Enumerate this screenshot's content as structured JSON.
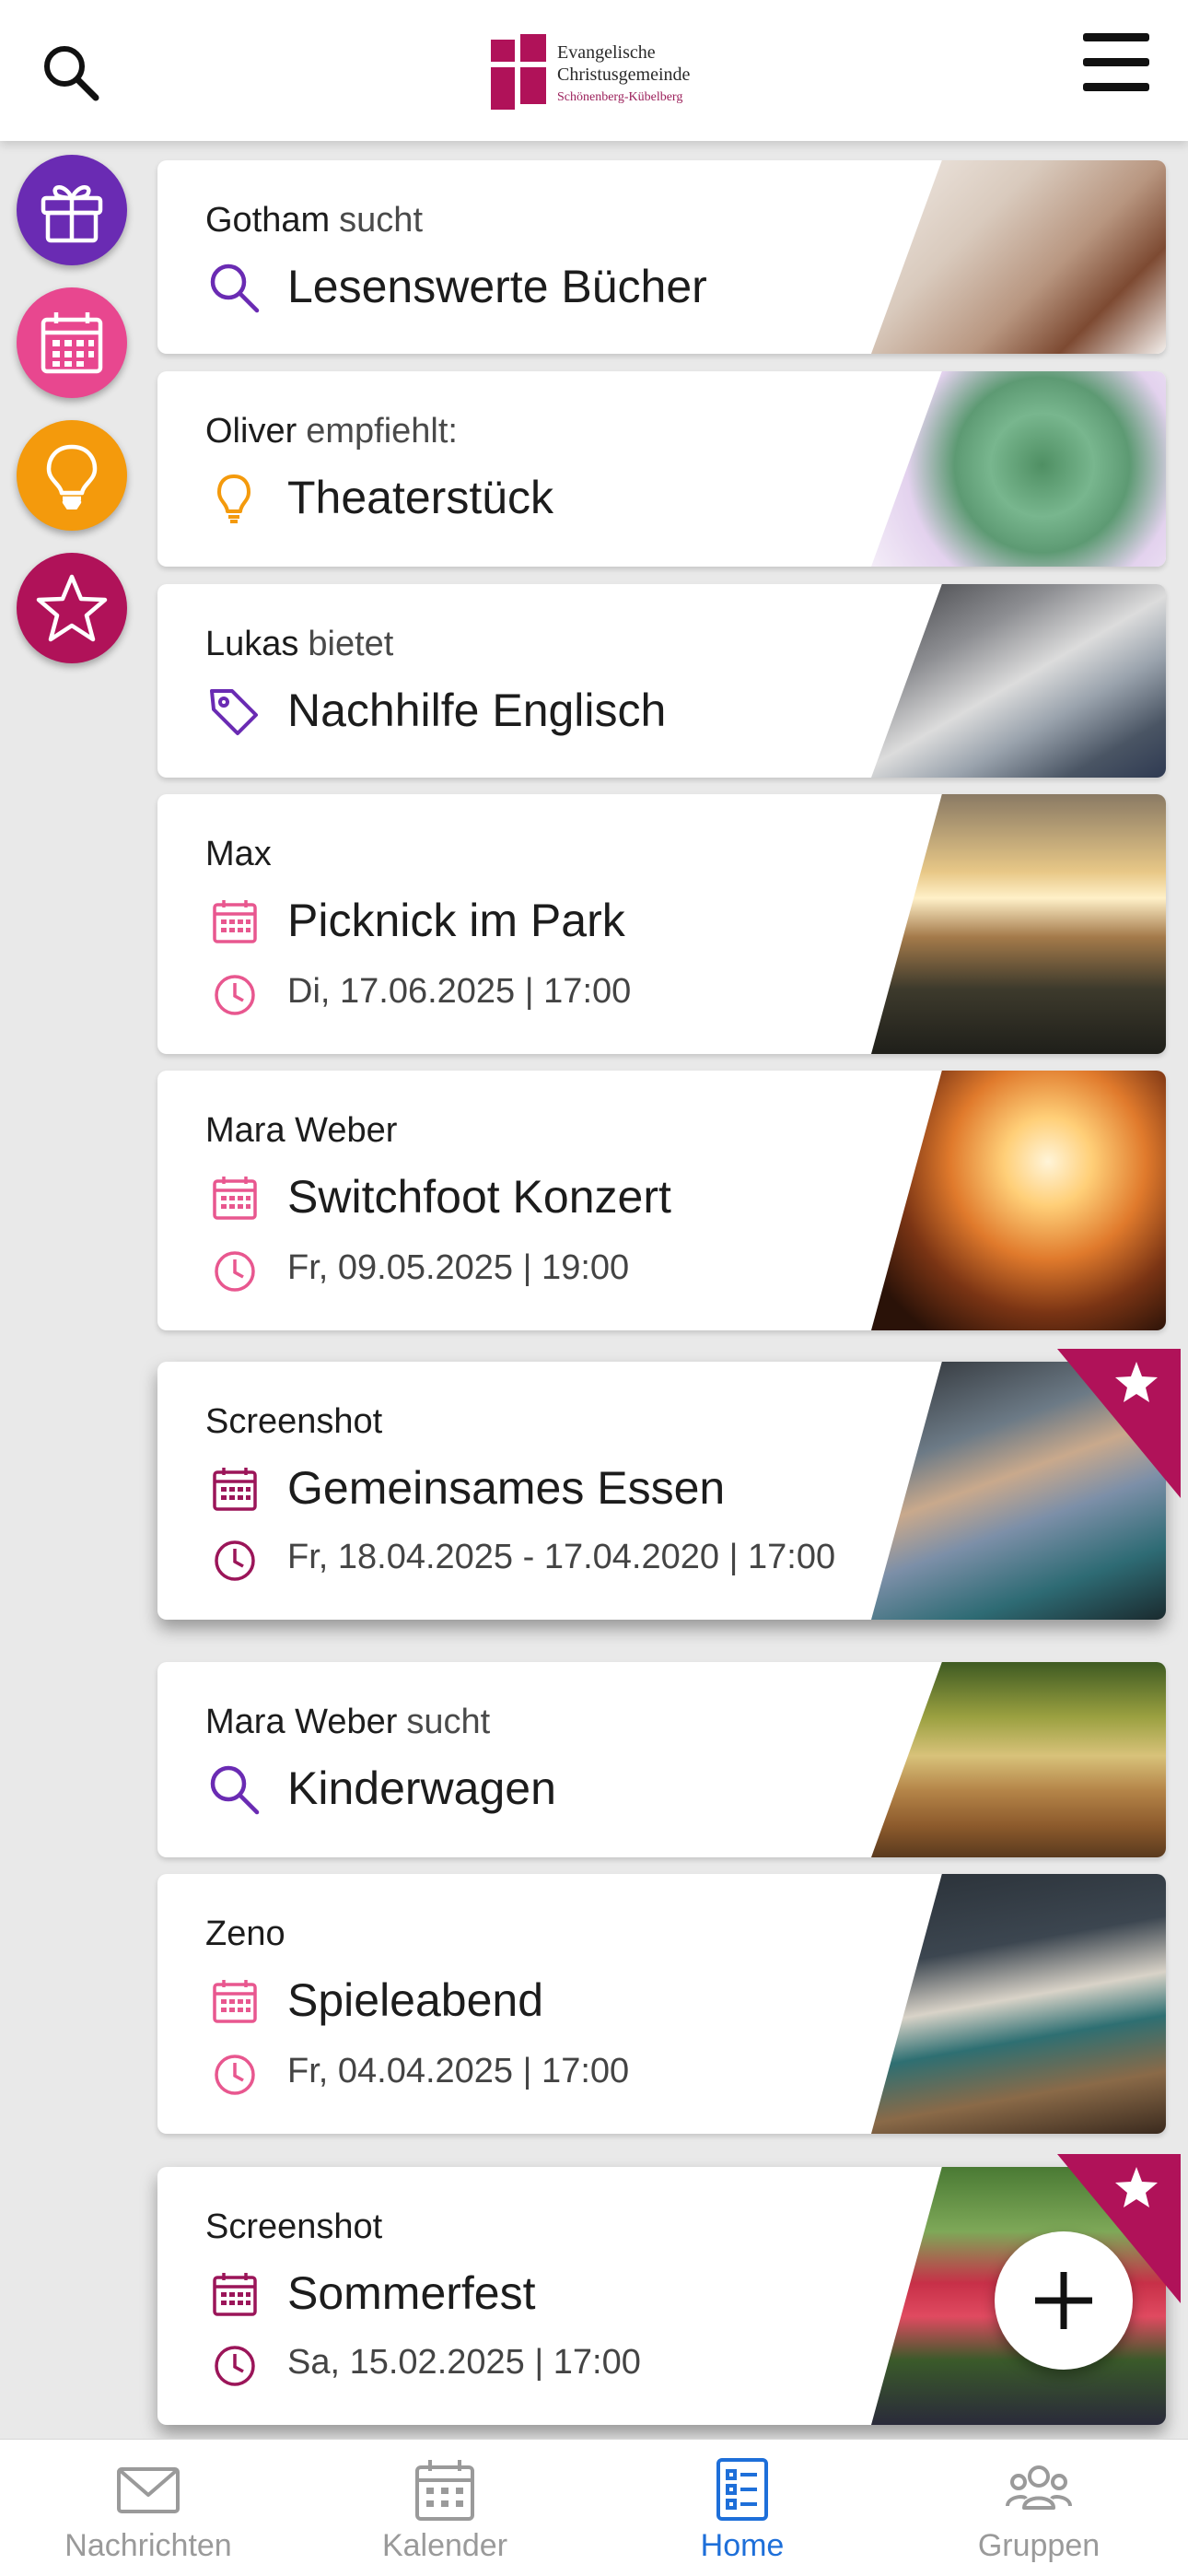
{
  "header": {
    "logo_line1": "Evangelische",
    "logo_line2": "Christusgemeinde",
    "logo_line3": "Schönenberg-Kübelberg",
    "search_icon": "search-icon",
    "menu_icon": "hamburger-menu-icon"
  },
  "side_filters": [
    {
      "name": "gift",
      "color": "#6a2bb3"
    },
    {
      "name": "calendar",
      "color": "#e8478f"
    },
    {
      "name": "idea",
      "color": "#f49a0c"
    },
    {
      "name": "star",
      "color": "#b01259"
    }
  ],
  "cards": [
    {
      "author": "Gotham",
      "verb": "sucht",
      "title": "Lesenswerte Bücher",
      "icon": "search-icon",
      "icon_color": "#6a2bb3"
    },
    {
      "author": "Oliver",
      "verb": "empfiehlt:",
      "title": "Theaterstück",
      "icon": "lightbulb-icon",
      "icon_color": "#f49a0c"
    },
    {
      "author": "Lukas",
      "verb": "bietet",
      "title": "Nachhilfe Englisch",
      "icon": "tag-icon",
      "icon_color": "#6a2bb3"
    },
    {
      "author": "Max",
      "title": "Picknick im Park",
      "date": "Di, 17.06.2025 | 17:00",
      "icon": "calendar-icon",
      "icon_color": "#e8578f"
    },
    {
      "author": "Mara Weber",
      "title": "Switchfoot Konzert",
      "date": "Fr, 09.05.2025 | 19:00",
      "icon": "calendar-icon",
      "icon_color": "#e8578f"
    },
    {
      "author": "Screenshot",
      "title": "Gemeinsames Essen",
      "date": "Fr, 18.04.2025 - 17.04.2020 | 17:00",
      "icon": "calendar-icon",
      "icon_color": "#9b1559",
      "featured": true
    },
    {
      "author": "Mara Weber",
      "verb": "sucht",
      "title": "Kinderwagen",
      "icon": "search-icon",
      "icon_color": "#6a2bb3"
    },
    {
      "author": "Zeno",
      "title": "Spieleabend",
      "date": "Fr, 04.04.2025 | 17:00",
      "icon": "calendar-icon",
      "icon_color": "#e8578f"
    },
    {
      "author": "Screenshot",
      "title": "Sommerfest",
      "date": "Sa, 15.02.2025 | 17:00",
      "icon": "calendar-icon",
      "icon_color": "#9b1559",
      "featured": true
    }
  ],
  "fab": {
    "icon": "plus-icon"
  },
  "nav": [
    {
      "label": "Nachrichten",
      "icon": "mail-icon",
      "active": false
    },
    {
      "label": "Kalender",
      "icon": "calendar-icon",
      "active": false
    },
    {
      "label": "Home",
      "icon": "list-icon",
      "active": true
    },
    {
      "label": "Gruppen",
      "icon": "group-icon",
      "active": false
    }
  ],
  "colors": {
    "accent": "#1e6fd9",
    "brand": "#b01259"
  }
}
